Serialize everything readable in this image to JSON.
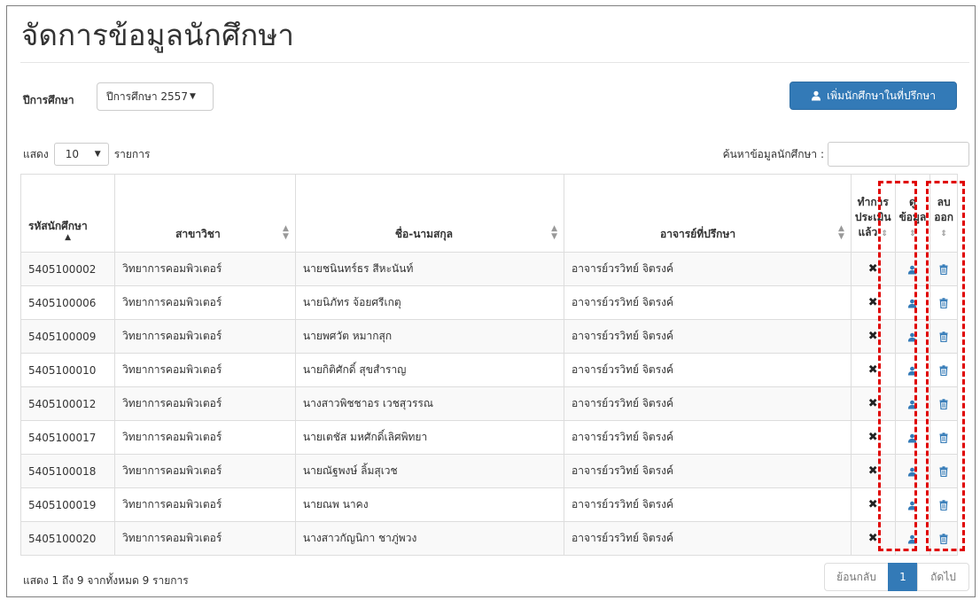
{
  "page": {
    "title": "จัดการข้อมูลนักศึกษา",
    "year_label": "ปีการศึกษา",
    "year_selected": "ปีการศึกษา 2557",
    "add_button": "เพิ่มนักศึกษาในที่ปรึกษา"
  },
  "length": {
    "prefix": "แสดง",
    "value": "10",
    "suffix": "รายการ"
  },
  "search": {
    "label": "ค้นหาข้อมูลนักศึกษา :",
    "placeholder": ""
  },
  "table": {
    "headers": {
      "id": "รหัสนักศึกษา",
      "major": "สาขาวิชา",
      "name": "ชื่อ-นามสกุล",
      "advisor": "อาจารย์ที่ปรึกษา",
      "assessed_l1": "ทำการ",
      "assessed_l2": "ประเมิน",
      "assessed_l3": "แล้ว",
      "view_l1": "ดู",
      "view_l2": "ข้อมูล",
      "del_l1": "ลบ",
      "del_l2": "ออก"
    },
    "rows": [
      {
        "id": "5405100002",
        "major": "วิทยาการคอมพิวเตอร์",
        "name": "นายชนินทร์ธร สีหะนันท์",
        "advisor": "อาจารย์วรวิทย์ จิตรงค์"
      },
      {
        "id": "5405100006",
        "major": "วิทยาการคอมพิวเตอร์",
        "name": "นายนิภัทร จ้อยศรีเกตุ",
        "advisor": "อาจารย์วรวิทย์ จิตรงค์"
      },
      {
        "id": "5405100009",
        "major": "วิทยาการคอมพิวเตอร์",
        "name": "นายพศวัต หมากสุก",
        "advisor": "อาจารย์วรวิทย์ จิตรงค์"
      },
      {
        "id": "5405100010",
        "major": "วิทยาการคอมพิวเตอร์",
        "name": "นายกิติศักดิ์ สุขสำราญ",
        "advisor": "อาจารย์วรวิทย์ จิตรงค์"
      },
      {
        "id": "5405100012",
        "major": "วิทยาการคอมพิวเตอร์",
        "name": "นางสาวพิชชาอร เวชสุวรรณ",
        "advisor": "อาจารย์วรวิทย์ จิตรงค์"
      },
      {
        "id": "5405100017",
        "major": "วิทยาการคอมพิวเตอร์",
        "name": "นายเตชัส มหศักดิ์เลิศพิทยา",
        "advisor": "อาจารย์วรวิทย์ จิตรงค์"
      },
      {
        "id": "5405100018",
        "major": "วิทยาการคอมพิวเตอร์",
        "name": "นายณัฐพงษ์ ลิ้มสุเวช",
        "advisor": "อาจารย์วรวิทย์ จิตรงค์"
      },
      {
        "id": "5405100019",
        "major": "วิทยาการคอมพิวเตอร์",
        "name": "นายณพ นาคง",
        "advisor": "อาจารย์วรวิทย์ จิตรงค์"
      },
      {
        "id": "5405100020",
        "major": "วิทยาการคอมพิวเตอร์",
        "name": "นางสาวกัญนิกา ชาภู่พวง",
        "advisor": "อาจารย์วรวิทย์ จิตรงค์"
      }
    ]
  },
  "footer": {
    "info": "แสดง 1 ถึง 9 จากทั้งหมด 9 รายการ",
    "prev": "ย้อนกลับ",
    "current": "1",
    "next": "ถัดไป"
  },
  "colors": {
    "primary": "#337ab7",
    "highlight": "#e00000"
  },
  "icons": {
    "add": "user-icon",
    "view": "user-icon",
    "delete": "trash-icon",
    "assessed": "x-mark-icon"
  }
}
